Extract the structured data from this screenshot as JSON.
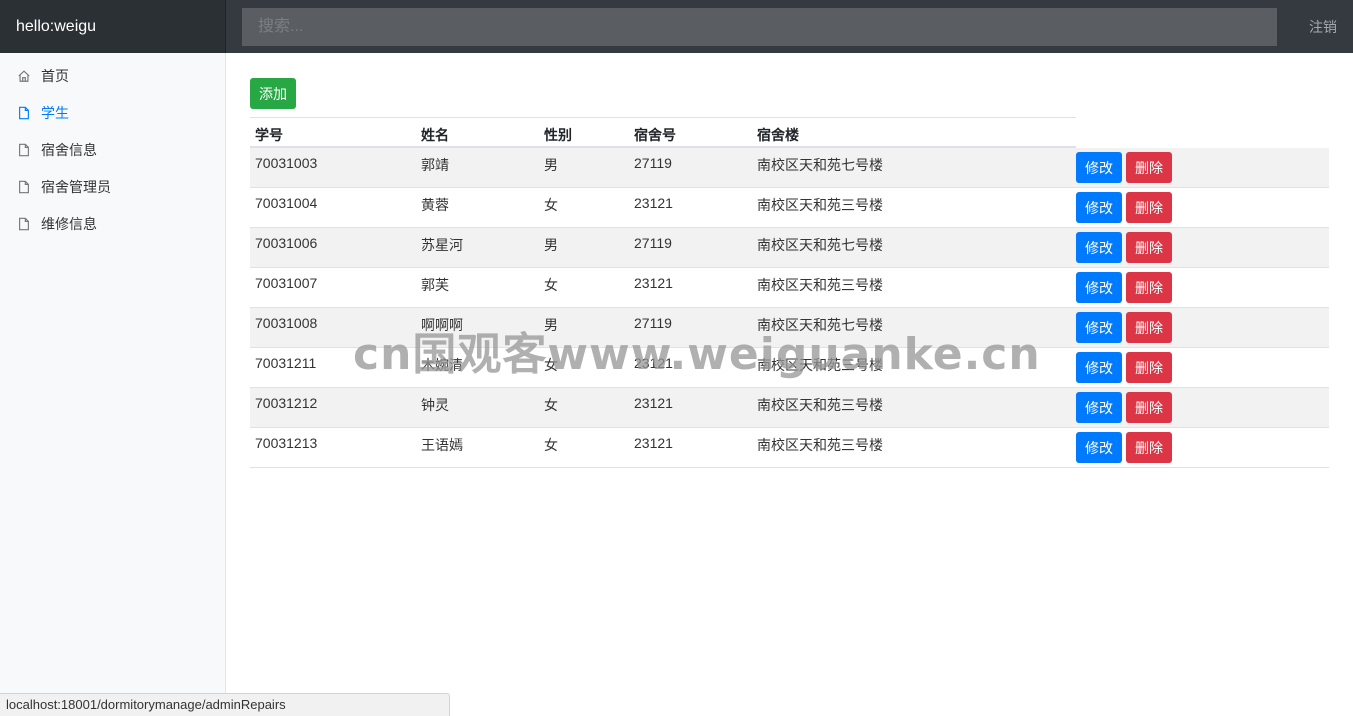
{
  "brand": "hello:weigu",
  "search": {
    "placeholder": "搜索..."
  },
  "signout_label": "注销",
  "sidebar": {
    "items": [
      {
        "label": "首页",
        "icon": "home-icon",
        "active": false
      },
      {
        "label": "学生",
        "icon": "file-icon",
        "active": true
      },
      {
        "label": "宿舍信息",
        "icon": "file-icon",
        "active": false
      },
      {
        "label": "宿舍管理员",
        "icon": "file-icon",
        "active": false
      },
      {
        "label": "维修信息",
        "icon": "file-icon",
        "active": false
      }
    ]
  },
  "add_label": "添加",
  "table": {
    "headers": [
      "学号",
      "姓名",
      "性别",
      "宿舍号",
      "宿舍楼"
    ],
    "edit_label": "修改",
    "delete_label": "删除",
    "rows": [
      [
        "70031003",
        "郭靖",
        "男",
        "27119",
        "南校区天和苑七号楼"
      ],
      [
        "70031004",
        "黄蓉",
        "女",
        "23121",
        "南校区天和苑三号楼"
      ],
      [
        "70031006",
        "苏星河",
        "男",
        "27119",
        "南校区天和苑七号楼"
      ],
      [
        "70031007",
        "郭芙",
        "女",
        "23121",
        "南校区天和苑三号楼"
      ],
      [
        "70031008",
        "啊啊啊",
        "男",
        "27119",
        "南校区天和苑七号楼"
      ],
      [
        "70031211",
        "木婉清",
        "女",
        "23121",
        "南校区天和苑三号楼"
      ],
      [
        "70031212",
        "钟灵",
        "女",
        "23121",
        "南校区天和苑三号楼"
      ],
      [
        "70031213",
        "王语嫣",
        "女",
        "23121",
        "南校区天和苑三号楼"
      ]
    ]
  },
  "watermark": "cn国观客www.weiguanke.cn",
  "status_url": "localhost:18001/dormitorymanage/adminRepairs",
  "colors": {
    "accent": "#007bff",
    "success": "#28a745",
    "danger": "#dc3545",
    "topbar": "#343a40"
  }
}
